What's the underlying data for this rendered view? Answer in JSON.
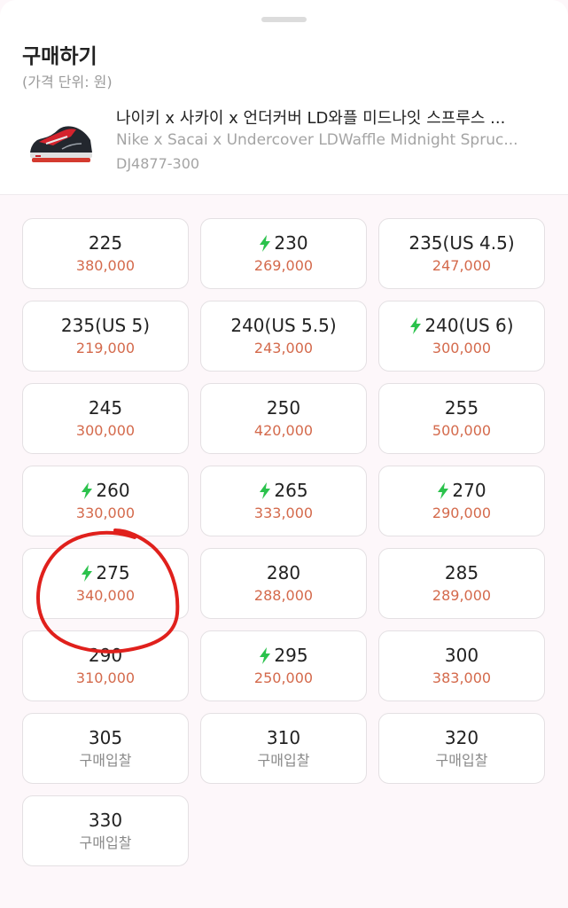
{
  "header": {
    "title": "구매하기",
    "unit": "(가격 단위: 원)"
  },
  "product": {
    "name_ko": "나이키 x 사카이 x 언더커버 LD와플 미드나잇 스프루스 ...",
    "name_en": "Nike x Sacai x Undercover LDWaffle Midnight Spruc...",
    "code": "DJ4877-300"
  },
  "colors": {
    "price": "#d46a4c",
    "bolt": "#2bc24c",
    "annotation": "#e0201c"
  },
  "sizes": [
    {
      "label": "225",
      "price": "380,000",
      "fast": false
    },
    {
      "label": "230",
      "price": "269,000",
      "fast": true
    },
    {
      "label": "235(US 4.5)",
      "price": "247,000",
      "fast": false
    },
    {
      "label": "235(US 5)",
      "price": "219,000",
      "fast": false
    },
    {
      "label": "240(US 5.5)",
      "price": "243,000",
      "fast": false
    },
    {
      "label": "240(US 6)",
      "price": "300,000",
      "fast": true
    },
    {
      "label": "245",
      "price": "300,000",
      "fast": false
    },
    {
      "label": "250",
      "price": "420,000",
      "fast": false
    },
    {
      "label": "255",
      "price": "500,000",
      "fast": false
    },
    {
      "label": "260",
      "price": "330,000",
      "fast": true
    },
    {
      "label": "265",
      "price": "333,000",
      "fast": true
    },
    {
      "label": "270",
      "price": "290,000",
      "fast": true
    },
    {
      "label": "275",
      "price": "340,000",
      "fast": true
    },
    {
      "label": "280",
      "price": "288,000",
      "fast": false
    },
    {
      "label": "285",
      "price": "289,000",
      "fast": false
    },
    {
      "label": "290",
      "price": "310,000",
      "fast": false
    },
    {
      "label": "295",
      "price": "250,000",
      "fast": true
    },
    {
      "label": "300",
      "price": "383,000",
      "fast": false
    },
    {
      "label": "305",
      "price": "구매입찰",
      "fast": false,
      "bid": true
    },
    {
      "label": "310",
      "price": "구매입찰",
      "fast": false,
      "bid": true
    },
    {
      "label": "320",
      "price": "구매입찰",
      "fast": false,
      "bid": true
    },
    {
      "label": "330",
      "price": "구매입찰",
      "fast": false,
      "bid": true
    }
  ]
}
